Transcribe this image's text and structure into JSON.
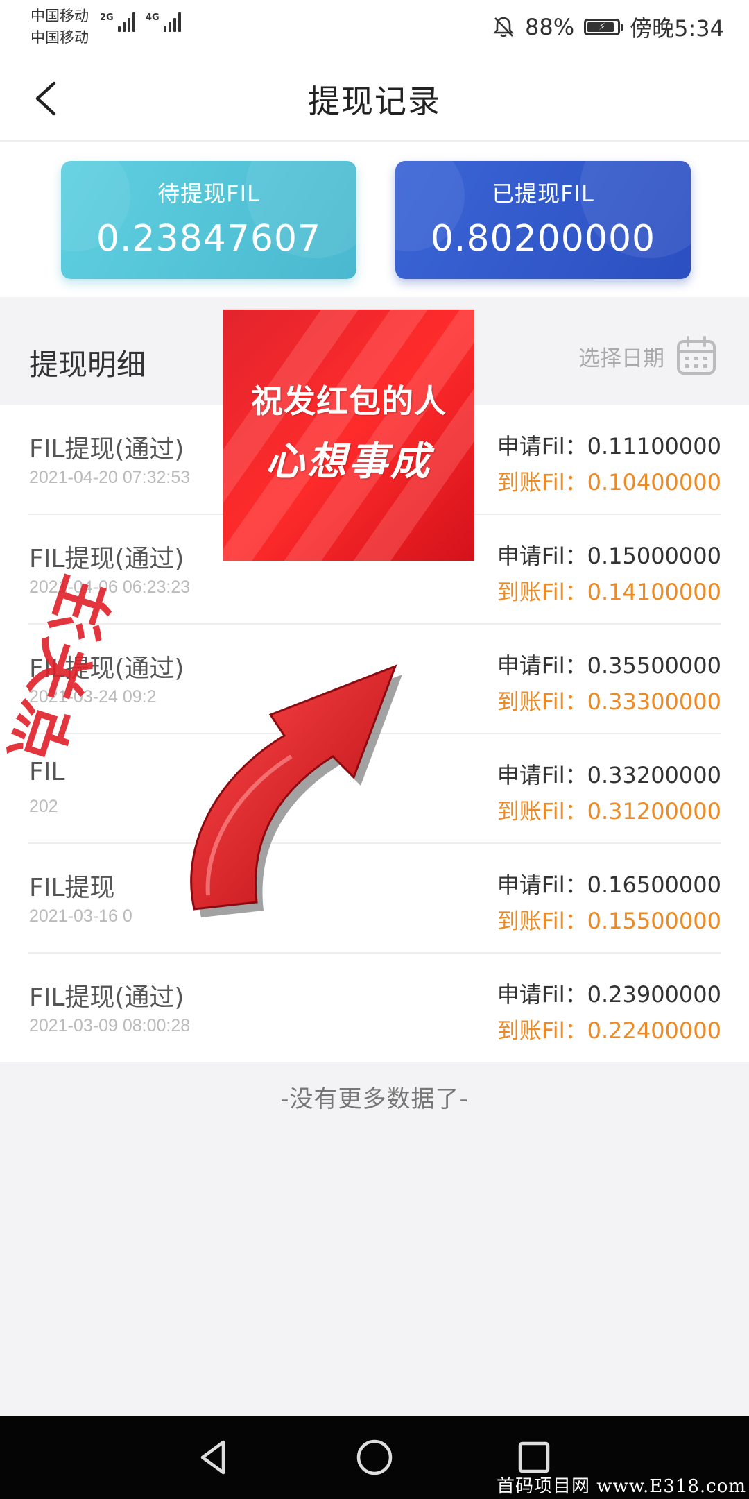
{
  "status_bar": {
    "carrier_1": "中国移动",
    "carrier_2": "中国移动",
    "network_1": "2G",
    "network_2": "4G",
    "battery": "88%",
    "time": "傍晚5:34",
    "icons": [
      "mute-bell-icon",
      "battery-charging-icon",
      "signal-icon"
    ]
  },
  "header": {
    "title": "提现记录",
    "back_icon": "chevron-left-icon"
  },
  "summary": {
    "pending_label": "待提现FIL",
    "pending_value": "0.23847607",
    "done_label": "已提现FIL",
    "done_value": "0.80200000",
    "pending_color": "#4ab8cf",
    "done_color": "#2b4fc0"
  },
  "section": {
    "title": "提现明细",
    "date_picker_label": "选择日期",
    "date_icon": "calendar-icon"
  },
  "records": [
    {
      "title": "FIL提现(通过)",
      "time": "2021-04-20 07:32:53",
      "apply": "申请Fil：0.11100000",
      "arrive": "到账Fil：0.10400000"
    },
    {
      "title": "FIL提现(通过)",
      "time": "2021-04-06 06:23:23",
      "apply": "申请Fil：0.15000000",
      "arrive": "到账Fil：0.14100000"
    },
    {
      "title": "FIL提现(通过)",
      "time": "2021-03-24 09:2",
      "apply": "申请Fil：0.35500000",
      "arrive": "到账Fil：0.33300000"
    },
    {
      "title": "FIL",
      "time": "202",
      "apply": "申请Fil：0.33200000",
      "arrive": "到账Fil：0.31200000"
    },
    {
      "title": "FIL提现",
      "time": "2021-03-16 0",
      "apply": "申请Fil：0.16500000",
      "arrive": "到账Fil：0.15500000"
    },
    {
      "title": "FIL提现(通过)",
      "time": "2021-03-09 08:00:28",
      "apply": "申请Fil：0.23900000",
      "arrive": "到账Fil：0.22400000"
    }
  ],
  "no_more": "-没有更多数据了-",
  "overlay": {
    "promo_line1": "祝发红包的人",
    "promo_line2": "心想事成",
    "stamp_text": "点关注",
    "arrow_icon": "curved-arrow-icon"
  },
  "system_nav": {
    "back_icon": "triangle-back-icon",
    "home_icon": "circle-home-icon",
    "recent_icon": "square-recent-icon"
  },
  "watermark": "首码项目网 www.E318.com",
  "accent_color": "#ec8b25"
}
